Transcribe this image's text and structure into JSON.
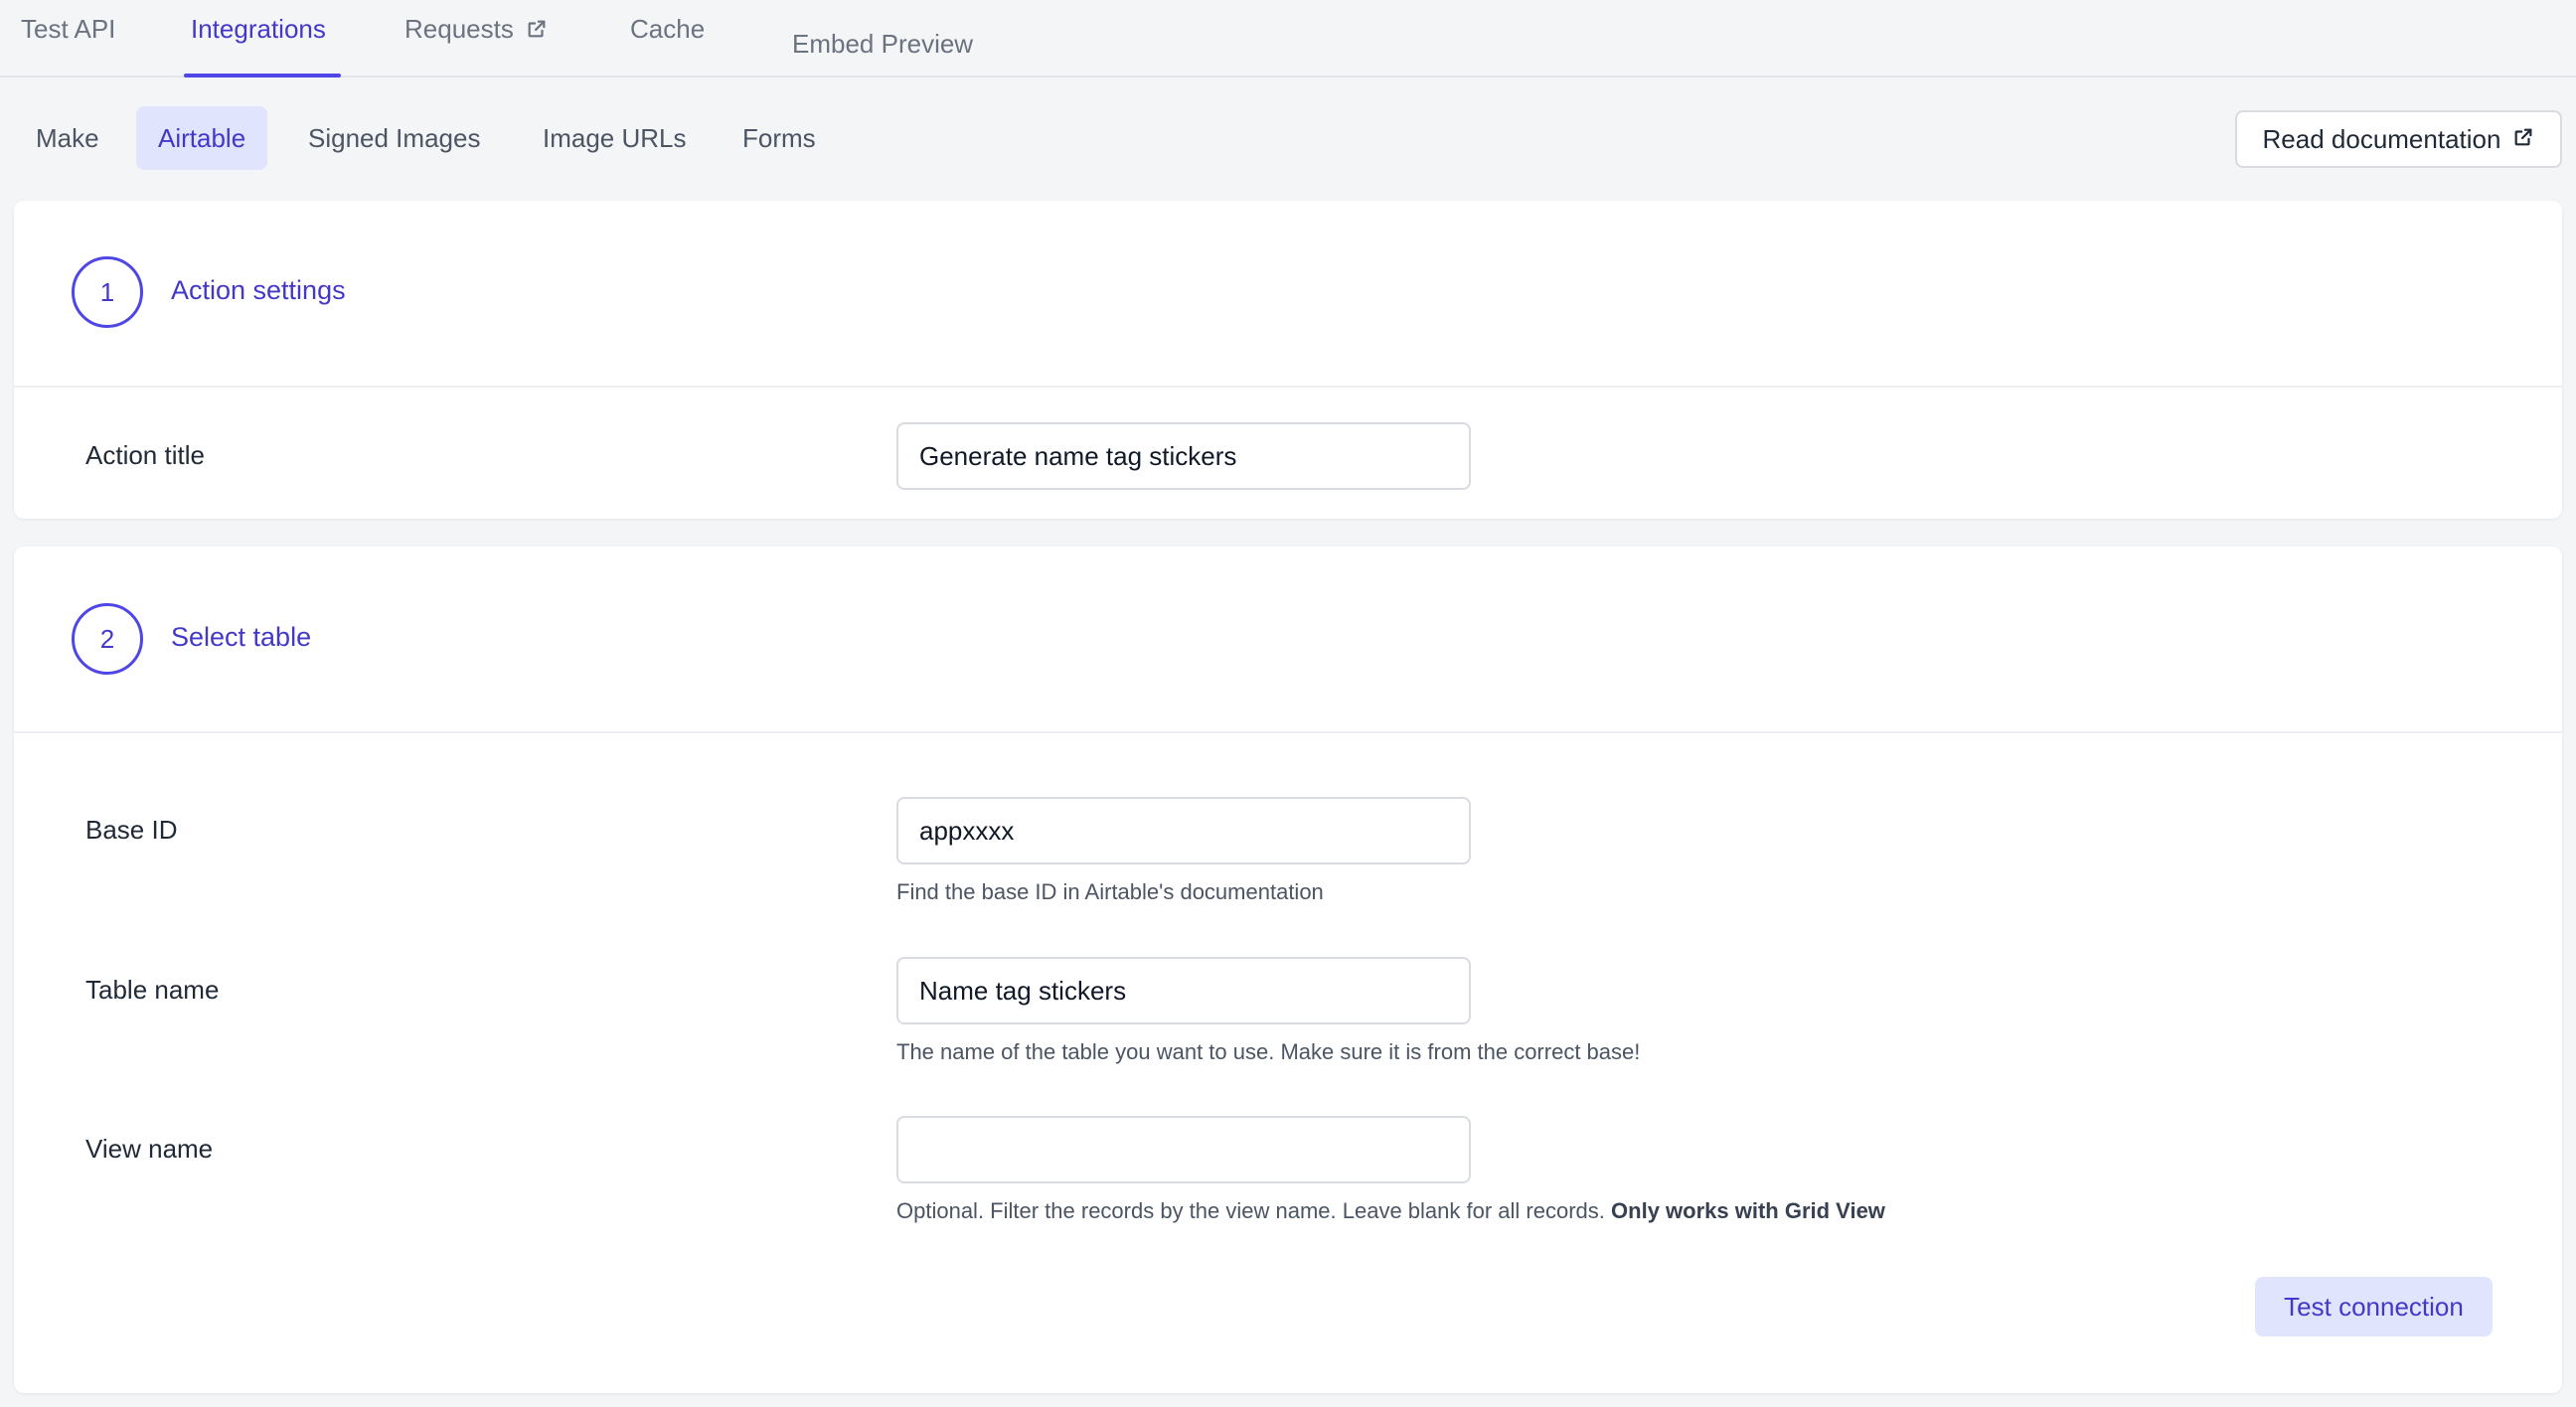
{
  "top_tabs": [
    {
      "label": "Test API"
    },
    {
      "label": "Integrations",
      "active": true
    },
    {
      "label": "Requests",
      "icon": "external-link-icon"
    },
    {
      "label": "Cache"
    },
    {
      "label": "Embed Preview"
    }
  ],
  "sub_tabs": [
    {
      "label": "Make"
    },
    {
      "label": "Airtable",
      "active": true
    },
    {
      "label": "Signed Images"
    },
    {
      "label": "Image URLs"
    },
    {
      "label": "Forms"
    }
  ],
  "doc_button": {
    "label": "Read documentation",
    "icon": "external-link-icon"
  },
  "section1": {
    "step": "1",
    "title": "Action settings",
    "fields": {
      "action_title": {
        "label": "Action title",
        "value": "Generate name tag stickers"
      }
    }
  },
  "section2": {
    "step": "2",
    "title": "Select table",
    "fields": {
      "base_id": {
        "label": "Base ID",
        "value": "appxxxx",
        "help": "Find the base ID in Airtable's documentation"
      },
      "table_name": {
        "label": "Table name",
        "value": "Name tag stickers",
        "help": "The name of the table you want to use. Make sure it is from the correct base!"
      },
      "view_name": {
        "label": "View name",
        "value": "",
        "help": "Optional. Filter the records by the view name. Leave blank for all records.",
        "help_bold": "Only works with Grid View"
      }
    },
    "test_button": "Test connection"
  },
  "colors": {
    "accent": "#4f46e5",
    "accent_text": "#4338ca",
    "active_tab_bg": "#e0e4fc",
    "page_bg": "#f4f5f7"
  }
}
